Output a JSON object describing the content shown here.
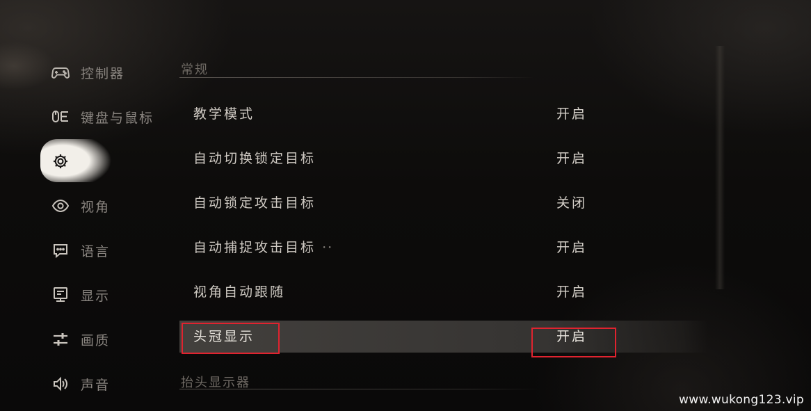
{
  "sidebar": {
    "items": [
      {
        "label": "控制器",
        "icon": "gamepad-icon"
      },
      {
        "label": "键盘与鼠标",
        "icon": "keyboard-mouse-icon"
      },
      {
        "label": "",
        "icon": "gear-icon",
        "active": true
      },
      {
        "label": "视角",
        "icon": "eye-icon"
      },
      {
        "label": "语言",
        "icon": "chat-icon"
      },
      {
        "label": "显示",
        "icon": "monitor-icon"
      },
      {
        "label": "画质",
        "icon": "sliders-icon"
      },
      {
        "label": "声音",
        "icon": "speaker-icon"
      }
    ]
  },
  "main": {
    "section_general": "常规",
    "section_hud": "抬头显示器",
    "rows": [
      {
        "label": "教学模式",
        "value": "开启"
      },
      {
        "label": "自动切换锁定目标",
        "value": "开启"
      },
      {
        "label": "自动锁定攻击目标",
        "value": "关闭"
      },
      {
        "label": "自动捕捉攻击目标",
        "value": "开启",
        "suffix": "··"
      },
      {
        "label": "视角自动跟随",
        "value": "开启"
      },
      {
        "label": "头冠显示",
        "value": "开启",
        "selected": true
      }
    ]
  },
  "colors": {
    "highlight_box": "#e0232f",
    "active_nav": "#f2efe9"
  },
  "watermark": "www.wukong123.vip"
}
